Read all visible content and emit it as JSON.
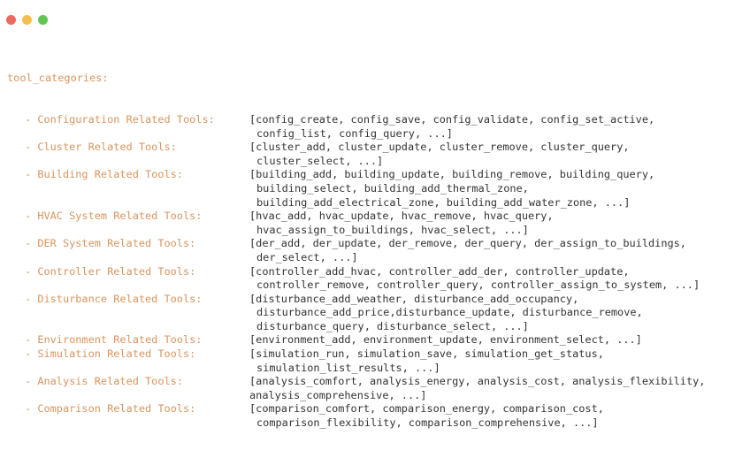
{
  "window": {
    "traffic_colors": [
      "#ed6a5e",
      "#f5bf4f",
      "#61c554"
    ]
  },
  "header": "tool_categories:",
  "categories": [
    {
      "label": "- Configuration Related Tools:",
      "lines": [
        "[config_create, config_save, config_validate, config_set_active,",
        "config_list, config_query, ...]"
      ]
    },
    {
      "label": "- Cluster Related Tools:",
      "lines": [
        "[cluster_add, cluster_update, cluster_remove, cluster_query,",
        "cluster_select, ...]"
      ]
    },
    {
      "label": "- Building Related Tools:",
      "lines": [
        "[building_add, building_update, building_remove, building_query,",
        "building_select, building_add_thermal_zone,",
        "building_add_electrical_zone, building_add_water_zone, ...]"
      ]
    },
    {
      "label": "- HVAC System Related Tools:",
      "lines": [
        "[hvac_add, hvac_update, hvac_remove, hvac_query,",
        "hvac_assign_to_buildings, hvac_select, ...]"
      ]
    },
    {
      "label": "- DER System Related Tools:",
      "lines": [
        "[der_add, der_update, der_remove, der_query, der_assign_to_buildings,",
        "der_select, ...]"
      ]
    },
    {
      "label": "- Controller Related Tools:",
      "lines": [
        "[controller_add_hvac, controller_add_der, controller_update,",
        "controller_remove, controller_query, controller_assign_to_system, ...]"
      ]
    },
    {
      "label": "- Disturbance Related Tools:",
      "lines": [
        "[disturbance_add_weather, disturbance_add_occupancy,",
        "disturbance_add_price,disturbance_update, disturbance_remove,",
        "disturbance_query, disturbance_select, ...]"
      ]
    },
    {
      "label": "- Environment Related Tools:",
      "lines": [
        "[environment_add, environment_update, environment_select, ...]"
      ]
    },
    {
      "label": "- Simulation Related Tools:",
      "lines": [
        "[simulation_run, simulation_save, simulation_get_status,",
        "simulation_list_results, ...]"
      ]
    },
    {
      "label": "- Analysis Related Tools:",
      "lines": [
        "[analysis_comfort, analysis_energy, analysis_cost, analysis_flexibility,",
        "analysis_comprehensive, ...]"
      ],
      "wide": true
    },
    {
      "label": "- Comparison Related Tools:",
      "lines": [
        "[comparison_comfort, comparison_energy, comparison_cost,",
        "comparison_flexibility, comparison_comprehensive, ...]"
      ]
    }
  ]
}
